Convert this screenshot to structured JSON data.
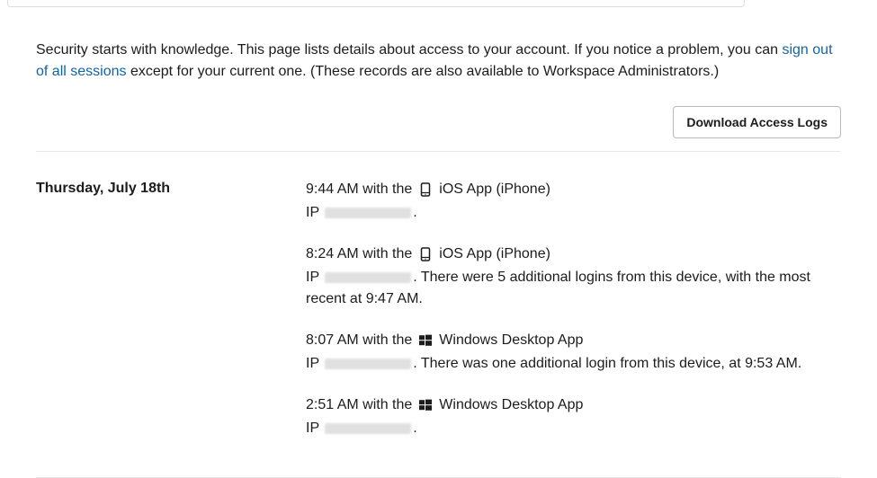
{
  "intro": {
    "before_link": "Security starts with knowledge. This page lists details about access to your account. If you notice a problem, you can ",
    "link_text": "sign out of all sessions",
    "after_link": " except for your current one. (These records are also available to Workspace Administrators.)"
  },
  "actions": {
    "download_label": "Download Access Logs"
  },
  "day": {
    "label": "Thursday, July 18th",
    "entries": [
      {
        "time": "9:44 AM",
        "with_the": "with the",
        "icon": "mobile-icon",
        "device": "iOS App (iPhone)",
        "ip_prefix": "IP",
        "ip_suffix": ".",
        "extra": ""
      },
      {
        "time": "8:24 AM",
        "with_the": "with the",
        "icon": "mobile-icon",
        "device": "iOS App (iPhone)",
        "ip_prefix": "IP",
        "ip_suffix": ".",
        "extra": " There were 5 additional logins from this device, with the most recent at 9:47 AM."
      },
      {
        "time": "8:07 AM",
        "with_the": "with the",
        "icon": "windows-icon",
        "device": "Windows Desktop App",
        "ip_prefix": "IP",
        "ip_suffix": ".",
        "extra": " There was one additional login from this device, at 9:53 AM."
      },
      {
        "time": "2:51 AM",
        "with_the": "with the",
        "icon": "windows-icon",
        "device": "Windows Desktop App",
        "ip_prefix": "IP",
        "ip_suffix": ".",
        "extra": ""
      }
    ]
  }
}
